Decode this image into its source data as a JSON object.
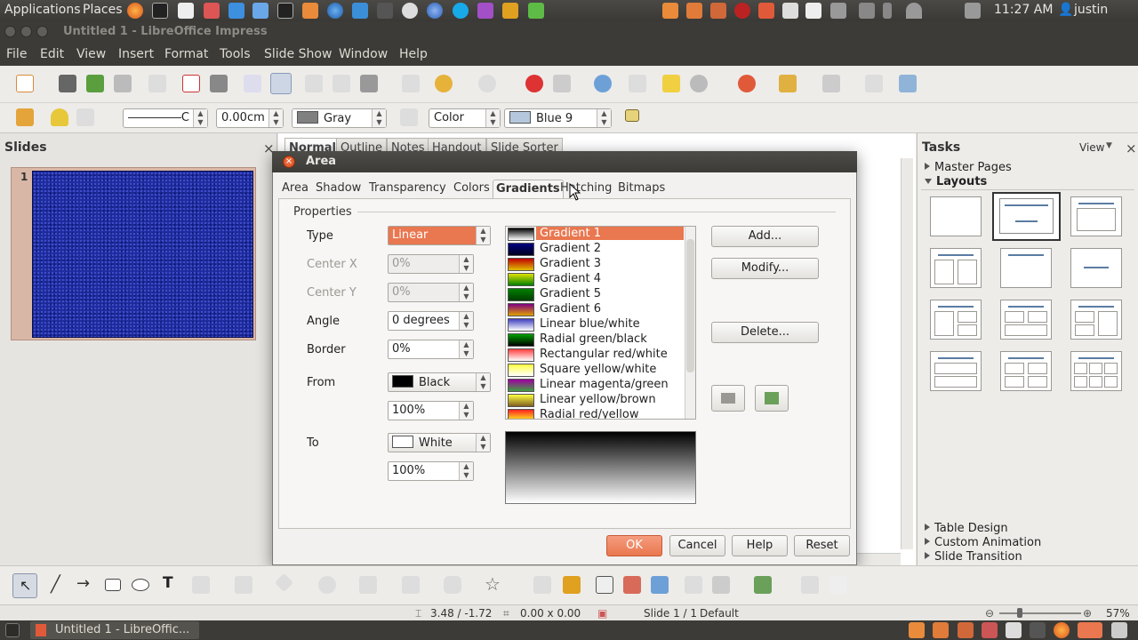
{
  "top_panel": {
    "applications": "Applications",
    "places": "Places",
    "clock": "11:27 AM",
    "user": "justin"
  },
  "window": {
    "title": "Untitled 1 - LibreOffice Impress"
  },
  "menu": [
    "File",
    "Edit",
    "View",
    "Insert",
    "Format",
    "Tools",
    "Slide Show",
    "Window",
    "Help"
  ],
  "line_toolbar": {
    "line_width": "0.00cm",
    "area_style": "Color",
    "line_color": "Gray",
    "fill_color": "Blue 9",
    "line_color_hex": "#808080",
    "fill_color_hex": "#b4c7dc",
    "line_style_letter": "C"
  },
  "slides_pane": {
    "title": "Slides",
    "close": "×",
    "slide_number": "1"
  },
  "view_tabs": [
    "Normal",
    "Outline",
    "Notes",
    "Handout",
    "Slide Sorter"
  ],
  "tasks_pane": {
    "title": "Tasks",
    "view": "View",
    "close": "×",
    "sections_top": [
      "Master Pages",
      "Layouts"
    ],
    "sections_bottom": [
      "Table Design",
      "Custom Animation",
      "Slide Transition"
    ]
  },
  "dialog": {
    "title": "Area",
    "tabs": [
      "Area",
      "Shadow",
      "Transparency",
      "Colors",
      "Gradients",
      "Hatching",
      "Bitmaps"
    ],
    "properties_label": "Properties",
    "type_label": "Type",
    "type_value": "Linear",
    "center_x_label": "Center X",
    "center_x_value": "0%",
    "center_y_label": "Center Y",
    "center_y_value": "0%",
    "angle_label": "Angle",
    "angle_value": "0 degrees",
    "border_label": "Border",
    "border_value": "0%",
    "from_label": "From",
    "from_color": "Black",
    "from_percent": "100%",
    "to_label": "To",
    "to_color": "White",
    "to_percent": "100%",
    "gradients": [
      {
        "name": "Gradient 1",
        "c1": "#000000",
        "c2": "#ffffff",
        "selected": true
      },
      {
        "name": "Gradient 2",
        "c1": "#000080",
        "c2": "#000020"
      },
      {
        "name": "Gradient 3",
        "c1": "#c00000",
        "c2": "#e0c000"
      },
      {
        "name": "Gradient 4",
        "c1": "#e0e000",
        "c2": "#008000"
      },
      {
        "name": "Gradient 5",
        "c1": "#008000",
        "c2": "#004000"
      },
      {
        "name": "Gradient 6",
        "c1": "#800080",
        "c2": "#e0a000"
      },
      {
        "name": "Linear blue/white",
        "c1": "#4040c0",
        "c2": "#ffffff"
      },
      {
        "name": "Radial green/black",
        "c1": "#00a000",
        "c2": "#000000"
      },
      {
        "name": "Rectangular red/white",
        "c1": "#ff4040",
        "c2": "#ffffff"
      },
      {
        "name": "Square yellow/white",
        "c1": "#ffff40",
        "c2": "#ffffff"
      },
      {
        "name": "Linear magenta/green",
        "c1": "#a000a0",
        "c2": "#40a040"
      },
      {
        "name": "Linear yellow/brown",
        "c1": "#ffff40",
        "c2": "#806020"
      },
      {
        "name": "Radial red/yellow",
        "c1": "#ff2020",
        "c2": "#ffff20"
      }
    ],
    "buttons": {
      "add": "Add...",
      "modify": "Modify...",
      "delete": "Delete...",
      "ok": "OK",
      "cancel": "Cancel",
      "help": "Help",
      "reset": "Reset"
    }
  },
  "status_bar": {
    "position": "3.48 / -1.72",
    "size": "0.00 x 0.00",
    "slide": "Slide 1 / 1",
    "master": "Default",
    "zoom": "57%"
  },
  "taskbar": {
    "window_label": "Untitled 1 - LibreOffic..."
  },
  "colors": {
    "accent": "#e9774f",
    "slide_bg": "#1c2a9c",
    "panel": "#3c3b37"
  }
}
